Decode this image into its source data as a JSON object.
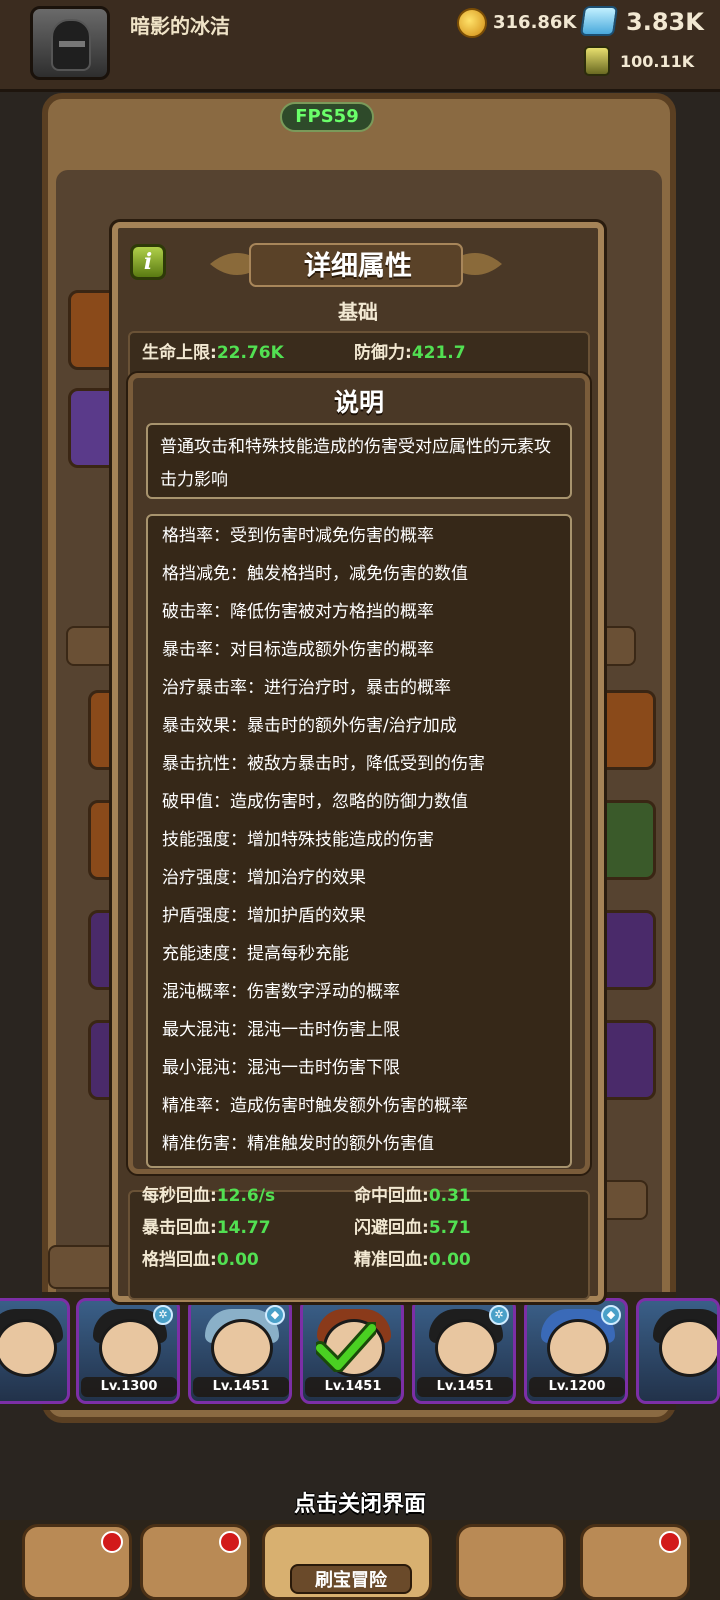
{
  "header": {
    "player_name": "暗影的冰洁",
    "gold": "316.86K",
    "gems": "3.83K",
    "essence": "100.11K"
  },
  "fps": "FPS59",
  "detail_dialog": {
    "title": "详细属性",
    "section": "基础",
    "top_stats": [
      {
        "label": "生命上限:",
        "value": "22.76K"
      },
      {
        "label": "防御力:",
        "value": "421.7"
      }
    ],
    "bottom_stats": [
      {
        "label": "每秒回血:",
        "value": "12.6/s"
      },
      {
        "label": "命中回血:",
        "value": "0.31"
      },
      {
        "label": "暴击回血:",
        "value": "14.77"
      },
      {
        "label": "闪避回血:",
        "value": "5.71"
      },
      {
        "label": "格挡回血:",
        "value": "0.00"
      },
      {
        "label": "精准回血:",
        "value": "0.00"
      }
    ]
  },
  "explain_dialog": {
    "title": "说明",
    "intro": "普通攻击和特殊技能造成的伤害受对应属性的元素攻击力影响",
    "items": [
      "格挡率：受到伤害时减免伤害的概率",
      "格挡减免：触发格挡时，减免伤害的数值",
      "破击率：降低伤害被对方格挡的概率",
      "暴击率：对目标造成额外伤害的概率",
      "治疗暴击率：进行治疗时，暴击的概率",
      "暴击效果：暴击时的额外伤害/治疗加成",
      "暴击抗性：被敌方暴击时，降低受到的伤害",
      "破甲值：造成伤害时，忽略的防御力数值",
      "技能强度：增加特殊技能造成的伤害",
      "治疗强度：增加治疗的效果",
      "护盾强度：增加护盾的效果",
      "充能速度：提高每秒充能",
      "混沌概率：伤害数字浮动的概率",
      "最大混沌：混沌一击时伤害上限",
      "最小混沌：混沌一击时伤害下限",
      "精准率：造成伤害时触发额外伤害的概率",
      "精准伤害：精准触发时的额外伤害值"
    ]
  },
  "heroes": [
    {
      "level": "Lv.1300"
    },
    {
      "level": "Lv.1451"
    },
    {
      "level": "Lv.1451"
    },
    {
      "level": "Lv.1451"
    },
    {
      "level": "Lv.1200"
    }
  ],
  "close_hint": "点击关闭界面",
  "bottom_nav": {
    "active_label": "刷宝冒险"
  }
}
